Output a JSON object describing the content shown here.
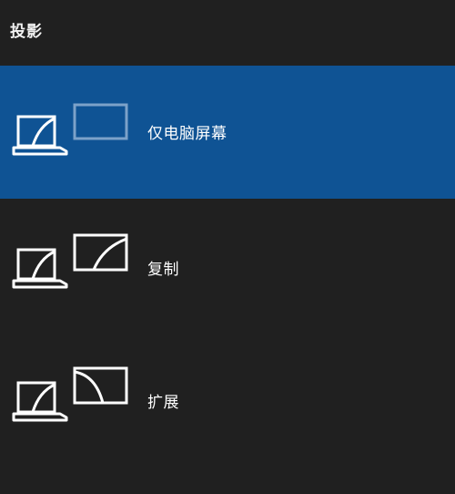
{
  "window": {
    "title": "投影"
  },
  "options": [
    {
      "label": "仅电脑屏幕",
      "icon": "pc-screen-only-icon",
      "selected": true
    },
    {
      "label": "复制",
      "icon": "duplicate-icon",
      "selected": false
    },
    {
      "label": "扩展",
      "icon": "extend-icon",
      "selected": false
    }
  ],
  "colors": {
    "background": "#202020",
    "selected": "#0f5394",
    "text": "#ffffff"
  }
}
